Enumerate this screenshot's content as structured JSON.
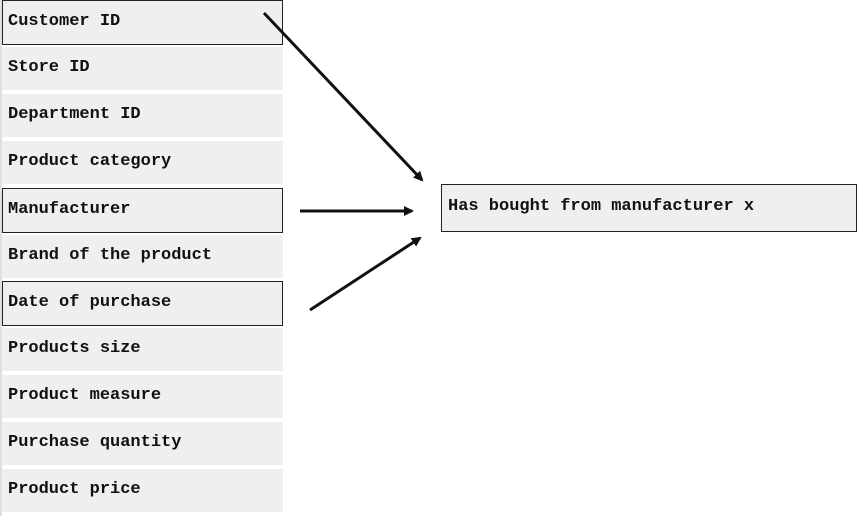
{
  "features": [
    {
      "label": "Customer ID",
      "selected": true
    },
    {
      "label": "Store ID",
      "selected": false
    },
    {
      "label": "Department ID",
      "selected": false
    },
    {
      "label": "Product category",
      "selected": false
    },
    {
      "label": "Manufacturer",
      "selected": true
    },
    {
      "label": "Brand of the product",
      "selected": false
    },
    {
      "label": "Date of purchase",
      "selected": true
    },
    {
      "label": "Products size",
      "selected": false
    },
    {
      "label": "Product measure",
      "selected": false
    },
    {
      "label": "Purchase quantity",
      "selected": false
    },
    {
      "label": "Product price",
      "selected": false
    }
  ],
  "target": {
    "label": "Has bought from manufacturer x"
  },
  "arrows": [
    {
      "from": "Customer ID",
      "to": "Has bought from manufacturer x"
    },
    {
      "from": "Manufacturer",
      "to": "Has bought from manufacturer x"
    },
    {
      "from": "Date of purchase",
      "to": "Has bought from manufacturer x"
    }
  ],
  "colors": {
    "cell_bg": "#efefef",
    "border": "#222222",
    "arrow": "#111111"
  }
}
